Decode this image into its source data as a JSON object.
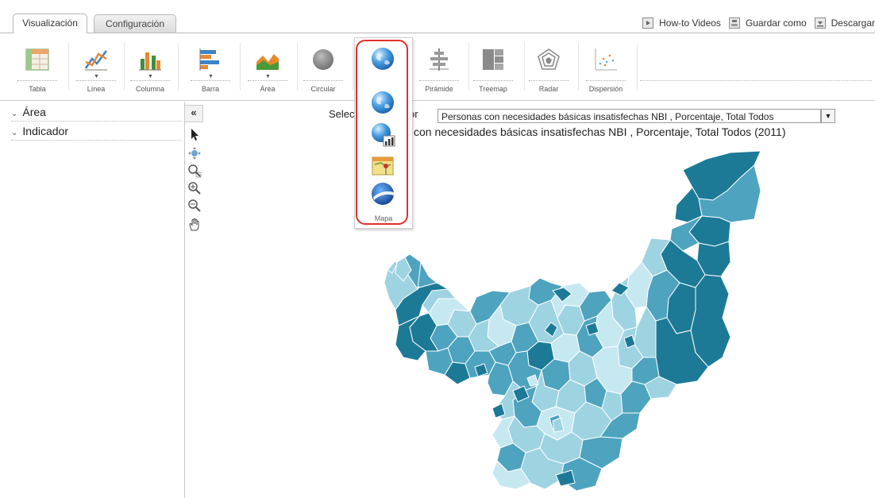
{
  "tabs": [
    {
      "label": "Visualización",
      "active": true
    },
    {
      "label": "Configuración",
      "active": false
    }
  ],
  "top_links": [
    {
      "label": "How-to Videos",
      "icon": "video-icon"
    },
    {
      "label": "Guardar como",
      "icon": "save-icon"
    },
    {
      "label": "Descargar",
      "icon": "download-icon"
    }
  ],
  "toolbar": {
    "tabla": "Tabla",
    "linea": "Línea",
    "columna": "Columna",
    "barra": "Barra",
    "area": "Área",
    "circular": "Circular",
    "piramide": "Pirámide",
    "treemap": "Treemap",
    "radar": "Radar",
    "dispersion": "Dispersión"
  },
  "map_popup": {
    "label": "Mapa"
  },
  "sidebar": {
    "items": [
      {
        "label": "Área"
      },
      {
        "label": "Indicador"
      }
    ]
  },
  "map_tools": [
    "pointer-icon",
    "pan-target-icon",
    "zoom-box-icon",
    "zoom-in-icon",
    "zoom-out-icon",
    "hand-icon"
  ],
  "indicator": {
    "selector_prefix": "Selec",
    "selector_suffix": "ador",
    "selected": "Personas con necesidades básicas insatisfechas NBI , Porcentaje, Total Todos",
    "title": "con necesidades básicas insatisfechas NBI , Porcentaje, Total Todos (2011)"
  },
  "colors": {
    "highlight": "#e0302a",
    "map_dark": "#1d7a96",
    "map_mid": "#4ea3bf",
    "map_light": "#9ed3e2",
    "map_pale": "#c6e8f1"
  }
}
